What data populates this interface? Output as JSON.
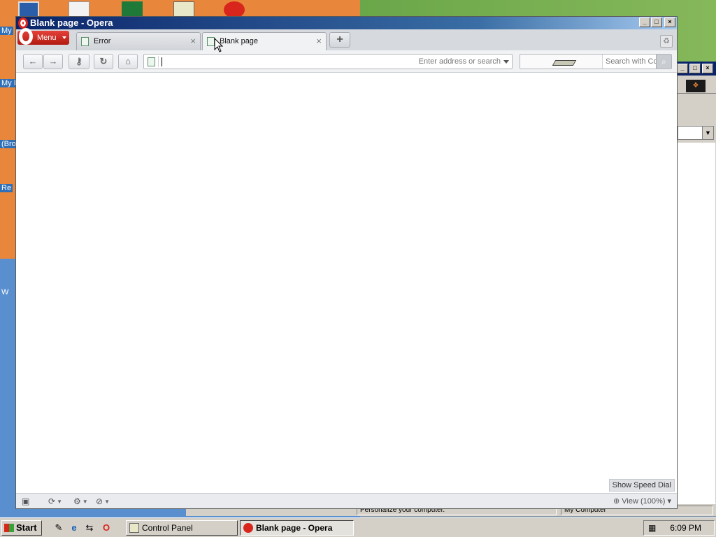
{
  "desktop": {
    "labels": [
      "My",
      "My I",
      "(Bro",
      "Re",
      "W"
    ]
  },
  "window": {
    "title": "Blank page - Opera"
  },
  "tabs": [
    {
      "label": "Error",
      "close": "×"
    },
    {
      "label": "Blank page",
      "close": "×"
    }
  ],
  "menu": {
    "label": "Menu"
  },
  "toolbar": {
    "back": "←",
    "forward": "→",
    "home": "⌂",
    "reload": "↻"
  },
  "address": {
    "value": "",
    "placeholder": "Enter address or search"
  },
  "search": {
    "placeholder": "Search with Co"
  },
  "page": {
    "speed_dial": "Show Speed Dial"
  },
  "status": {
    "zoom": "View (100%)"
  },
  "background_window": {
    "status_segments": [
      "Personalize your computer.",
      "My Computer"
    ]
  },
  "taskbar": {
    "start": "Start",
    "tasks": [
      {
        "label": "Control Panel",
        "active": false
      },
      {
        "label": "Blank page - Opera",
        "active": true
      }
    ],
    "clock": "6:09 PM"
  }
}
